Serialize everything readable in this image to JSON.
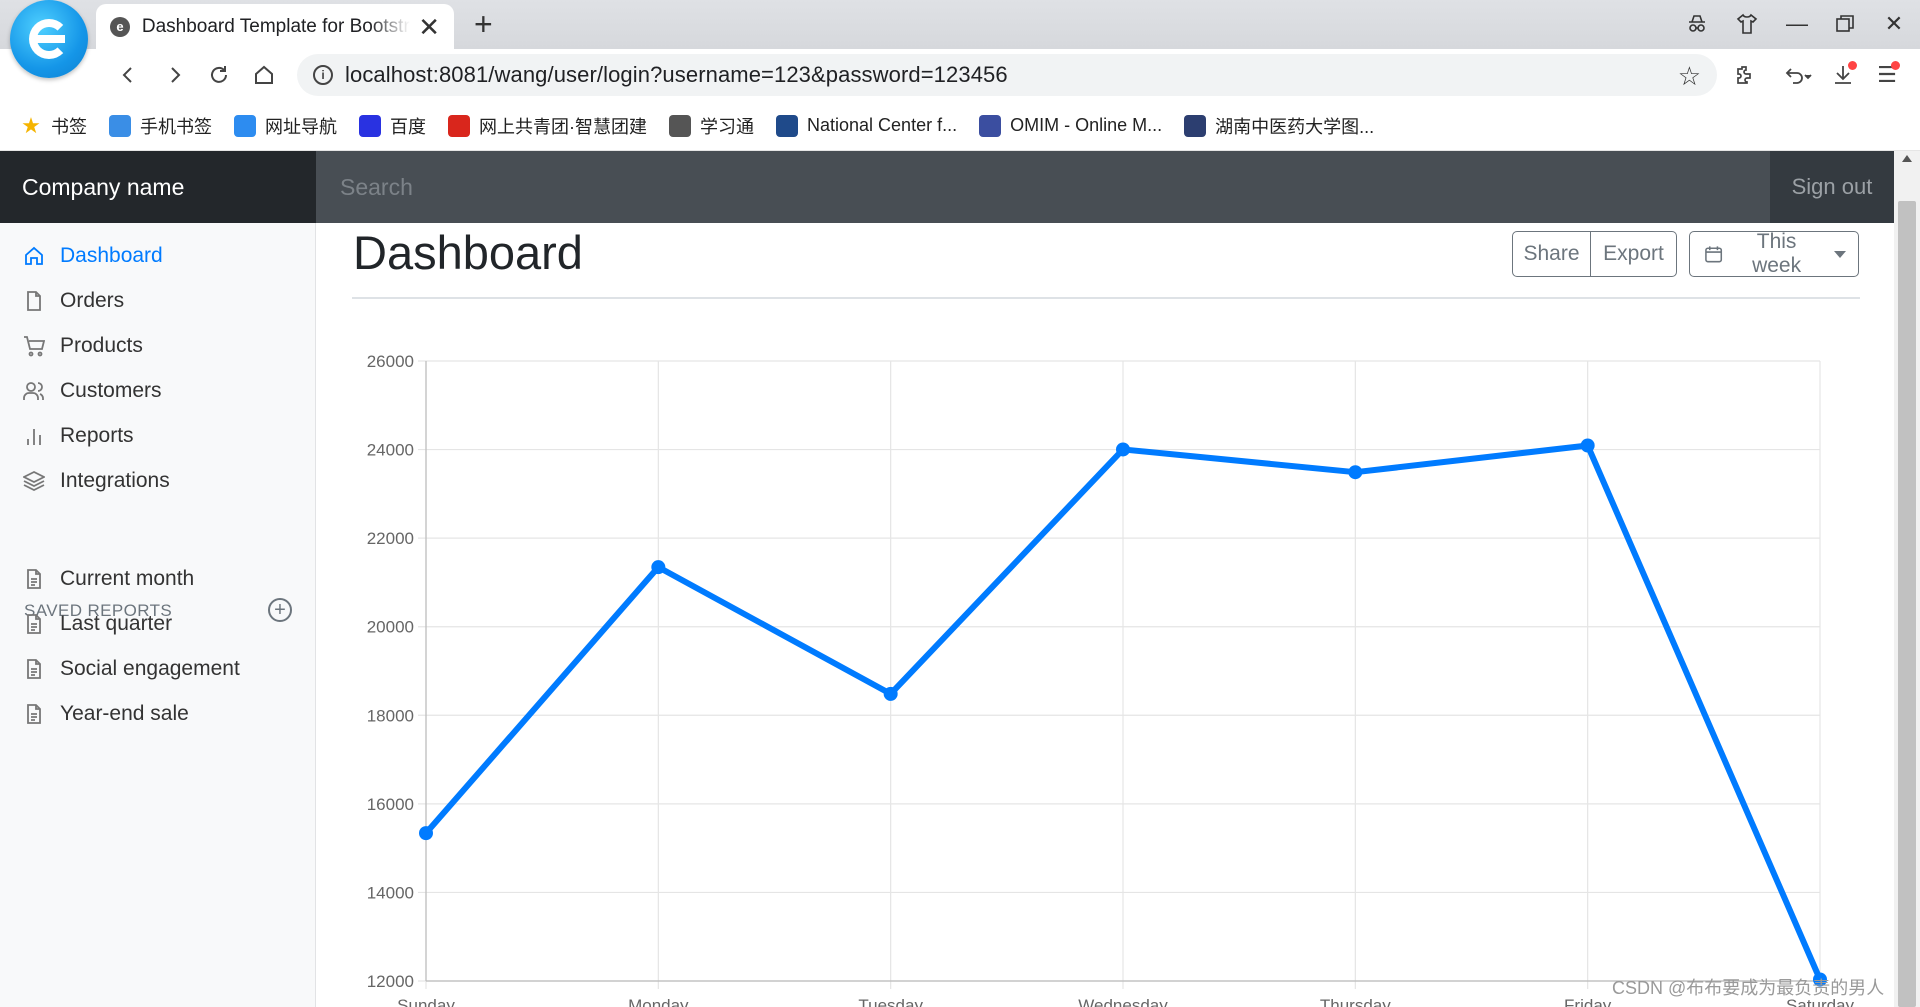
{
  "browser": {
    "tab_title": "Dashboard Template for Bootstrap",
    "tab_favicon": "e",
    "address_info": "i",
    "url": "localhost:8081/wang/user/login?username=123&password=123456",
    "bookmarks": [
      {
        "label": "书签",
        "icon": "star-icon",
        "color": "#f5b400"
      },
      {
        "label": "手机书签",
        "icon": "phone-icon",
        "color": "#3a8ee6"
      },
      {
        "label": "网址导航",
        "icon": "nav-icon",
        "color": "#2d8cf0"
      },
      {
        "label": "百度",
        "icon": "baidu-paw-icon",
        "color": "#2932e1"
      },
      {
        "label": "网上共青团·智慧团建",
        "icon": "youth-league-icon",
        "color": "#d9261c"
      },
      {
        "label": "学习通",
        "icon": "xuexitong-icon",
        "color": "#555555"
      },
      {
        "label": "National Center f...",
        "icon": "ncbi-icon",
        "color": "#1f4a8a"
      },
      {
        "label": "OMIM - Online M...",
        "icon": "omim-icon",
        "color": "#3b4ea0"
      },
      {
        "label": "湖南中医药大学图...",
        "icon": "library-icon",
        "color": "#2c3e70"
      }
    ]
  },
  "app": {
    "brand": "Company name",
    "search_placeholder": "Search",
    "signout_label": "Sign out",
    "sidebar": {
      "items": [
        {
          "label": "Dashboard",
          "icon": "home-icon",
          "active": true
        },
        {
          "label": "Orders",
          "icon": "file-icon",
          "active": false
        },
        {
          "label": "Products",
          "icon": "cart-icon",
          "active": false
        },
        {
          "label": "Customers",
          "icon": "users-icon",
          "active": false
        },
        {
          "label": "Reports",
          "icon": "bar-chart-icon",
          "active": false
        },
        {
          "label": "Integrations",
          "icon": "layers-icon",
          "active": false
        }
      ],
      "saved_heading": "SAVED REPORTS",
      "saved_items": [
        {
          "label": "Current month",
          "icon": "file-text-icon"
        },
        {
          "label": "Last quarter",
          "icon": "file-text-icon"
        },
        {
          "label": "Social engagement",
          "icon": "file-text-icon"
        },
        {
          "label": "Year-end sale",
          "icon": "file-text-icon"
        }
      ]
    },
    "main": {
      "title": "Dashboard",
      "share_label": "Share",
      "export_label": "Export",
      "week_label": "This week"
    },
    "accent_color": "#007bff"
  },
  "chart_data": {
    "type": "line",
    "categories": [
      "Sunday",
      "Monday",
      "Tuesday",
      "Wednesday",
      "Thursday",
      "Friday",
      "Saturday"
    ],
    "series": [
      {
        "values": [
          15339,
          21345,
          18483,
          24003,
          23489,
          24092,
          12034
        ],
        "color": "#007bff"
      }
    ],
    "yticks": [
      12000,
      14000,
      16000,
      18000,
      20000,
      22000,
      24000,
      26000
    ],
    "ylim": [
      12000,
      26000
    ],
    "grid": true,
    "legend": false
  },
  "watermark": "CSDN @布布要成为最负责的男人"
}
